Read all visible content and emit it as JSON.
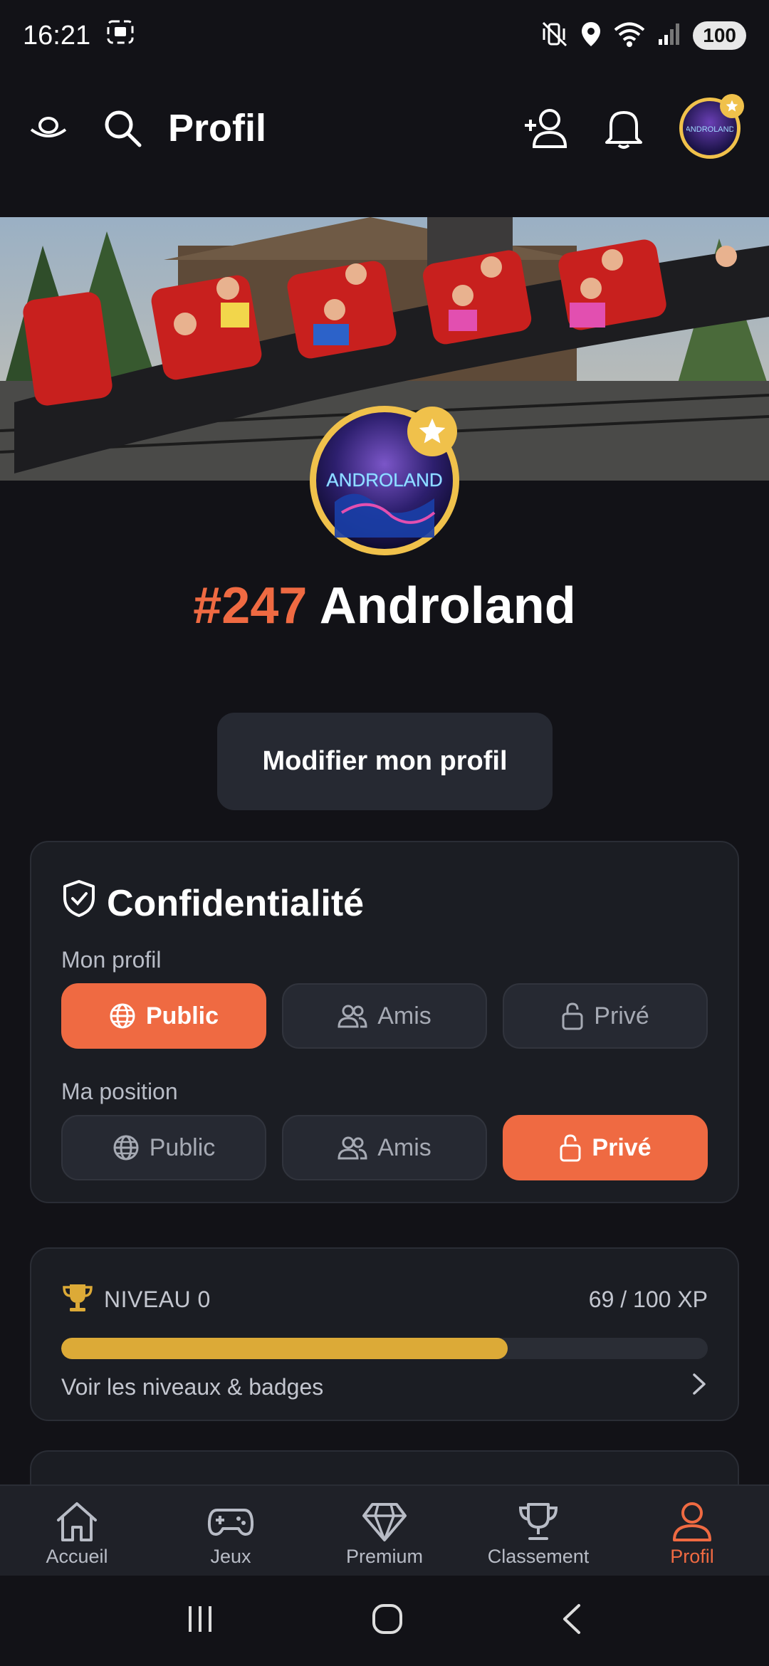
{
  "status_bar": {
    "time": "16:21",
    "battery": "100",
    "icons": [
      "screenshot-icon",
      "mute-vibrate-icon",
      "location-icon",
      "wifi-icon",
      "signal-icon"
    ]
  },
  "header": {
    "title": "Profil",
    "icons": [
      "logo-icon",
      "search-icon",
      "add-friend-icon",
      "bell-icon",
      "avatar"
    ]
  },
  "profile": {
    "rank": "#247",
    "name": "Androland",
    "avatar_text": "ANDROLAND",
    "edit_button": "Modifier mon profil"
  },
  "privacy": {
    "title": "Confidentialité",
    "profile_label": "Mon profil",
    "position_label": "Ma position",
    "options": [
      "Public",
      "Amis",
      "Privé"
    ],
    "profile_selected": "Public",
    "position_selected": "Privé",
    "accent_color": "#ef6a42"
  },
  "level": {
    "label": "NIVEAU 0",
    "xp": "69 / 100 XP",
    "xp_current": 69,
    "xp_max": 100,
    "link": "Voir les niveaux & badges",
    "bar_color": "#dcaa37"
  },
  "bottom_nav": {
    "items": [
      {
        "label": "Accueil",
        "icon": "home-icon"
      },
      {
        "label": "Jeux",
        "icon": "gamepad-icon"
      },
      {
        "label": "Premium",
        "icon": "diamond-icon"
      },
      {
        "label": "Classement",
        "icon": "trophy-icon"
      },
      {
        "label": "Profil",
        "icon": "user-icon"
      }
    ],
    "active": "Profil"
  }
}
